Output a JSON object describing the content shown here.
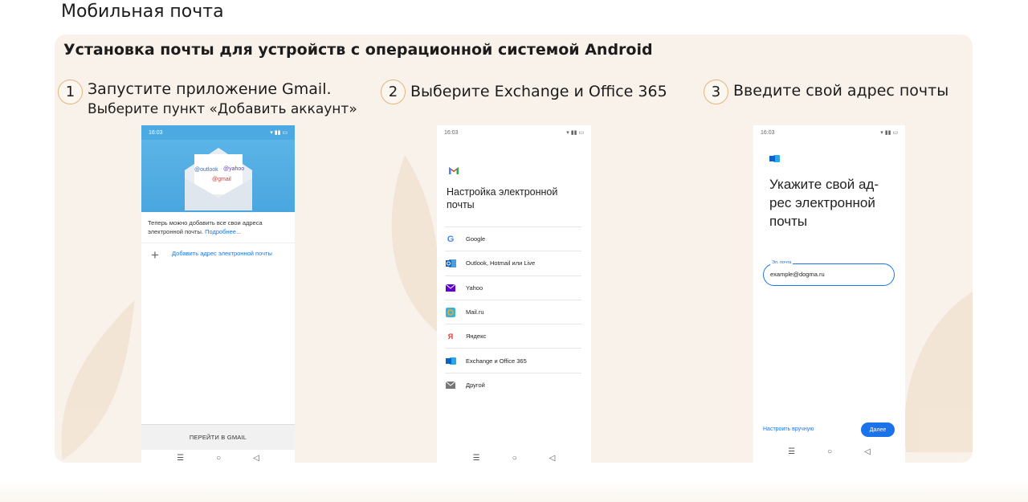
{
  "page": {
    "title": "Мобильная почта"
  },
  "panel": {
    "title": "Установка почты для устройств с операционной системой Android"
  },
  "steps": [
    {
      "num": "1",
      "line1": "Запустите приложение Gmail.",
      "line2": "Выберите пункт «Добавить аккаунт»"
    },
    {
      "num": "2",
      "line1": "Выберите Exchange и Office 365"
    },
    {
      "num": "3",
      "line1": "Введите свой адрес почты"
    }
  ],
  "phone1": {
    "time": "16:03",
    "envelope_labels": {
      "outlook": "@outlook",
      "yahoo": "@yahoo",
      "gmail": "@gmail"
    },
    "info_text": "Теперь можно добавить все свои адреса электронной почты.",
    "info_link": "Подробнее...",
    "add_label": "Добавить адрес электронной почты",
    "goto_label": "ПЕРЕЙТИ В GMAIL"
  },
  "phone2": {
    "time": "16:03",
    "title": "Настройка электронной почты",
    "providers": [
      {
        "label": "Google",
        "icon": "google-icon"
      },
      {
        "label": "Outlook, Hotmail или Live",
        "icon": "outlook-icon"
      },
      {
        "label": "Yahoo",
        "icon": "yahoo-icon"
      },
      {
        "label": "Mail.ru",
        "icon": "mailru-icon"
      },
      {
        "label": "Яндекс",
        "icon": "yandex-icon"
      },
      {
        "label": "Exchange и Office 365",
        "icon": "exchange-icon"
      },
      {
        "label": "Другой",
        "icon": "mail-icon"
      }
    ]
  },
  "phone3": {
    "time": "16:03",
    "heading": "Укажите свой ад-рес электронной почты",
    "email_label": "Эл. почта",
    "email_value": "example@dogma.ru",
    "manual_label": "Настроить вручную",
    "next_label": "Далее"
  },
  "colors": {
    "accent": "#1a73e8",
    "panel_bg": "#f9f2ea",
    "step_ring": "#e2b57f"
  }
}
